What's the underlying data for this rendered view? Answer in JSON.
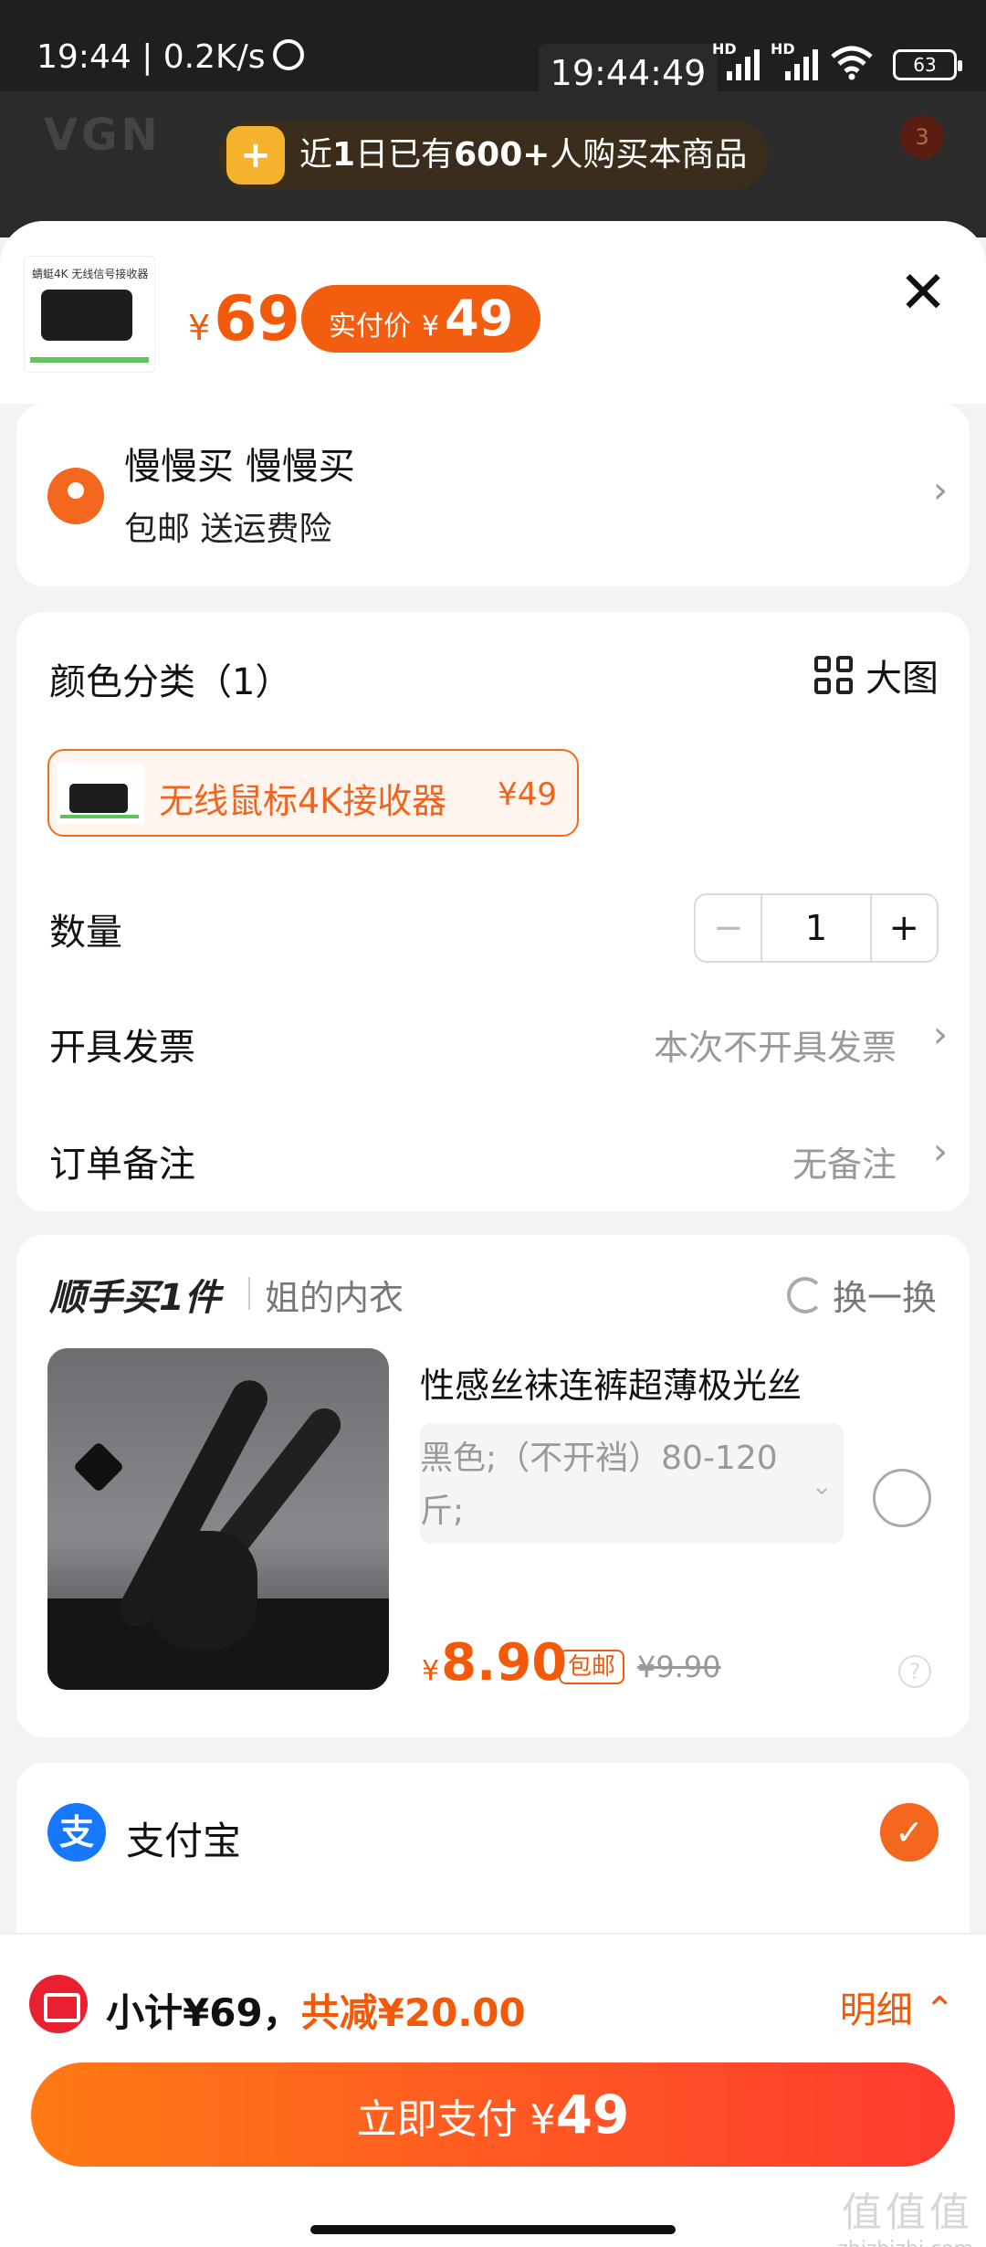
{
  "status_bar": {
    "time_speed": "19:44 | 0.2K/s",
    "clock": "19:44:49",
    "sim1": "HD",
    "sim2": "HD",
    "battery": "63"
  },
  "background": {
    "logo": "VGN",
    "banner_prefix": "近",
    "banner_days": "1",
    "banner_mid": "日已有",
    "banner_count": "600+",
    "banner_suffix": "人购买本商品",
    "badge": "3"
  },
  "product": {
    "thumb_caption": "蜻蜓4K 无线信号接收器",
    "price_yen": "¥",
    "price": "69",
    "pay_label": "实付价",
    "pay_yen": "¥",
    "pay_price": "49"
  },
  "address": {
    "name": "慢慢买 慢慢买",
    "sub": "包邮 送运费险"
  },
  "spec": {
    "title": "颜色分类（1）",
    "big_image": "大图",
    "variant_name": "无线鼠标4K接收器",
    "variant_price": "¥49",
    "quantity_label": "数量",
    "quantity_minus": "−",
    "quantity": "1",
    "quantity_plus": "+",
    "invoice_label": "开具发票",
    "invoice_value": "本次不开具发票",
    "note_label": "订单备注",
    "note_value": "无备注"
  },
  "addon": {
    "title": "顺手买1件",
    "category": "姐的内衣",
    "swap": "换一换",
    "item_name": "性感丝袜连裤超薄极光丝",
    "item_option": "黑色;（不开裆）80-120斤;",
    "item_yen": "¥",
    "item_price": "8.90",
    "free_shipping": "包邮",
    "original_price": "¥9.90"
  },
  "payment": {
    "method": "支付宝",
    "icon_char": "支"
  },
  "footer": {
    "subtotal": "小计¥69，",
    "discount": "共减¥20.00",
    "detail": "明细",
    "pay_button_label": "立即支付 ",
    "pay_button_yen": "¥",
    "pay_button_amount": "49"
  },
  "watermark": {
    "big": "值值值",
    "small": "zhizhizhi.com"
  },
  "colors": {
    "accent_orange": "#f25a0a",
    "alipay_blue": "#1677ff",
    "pay_gradient_start": "#ff7a14",
    "pay_gradient_end": "#ff3b2f"
  }
}
